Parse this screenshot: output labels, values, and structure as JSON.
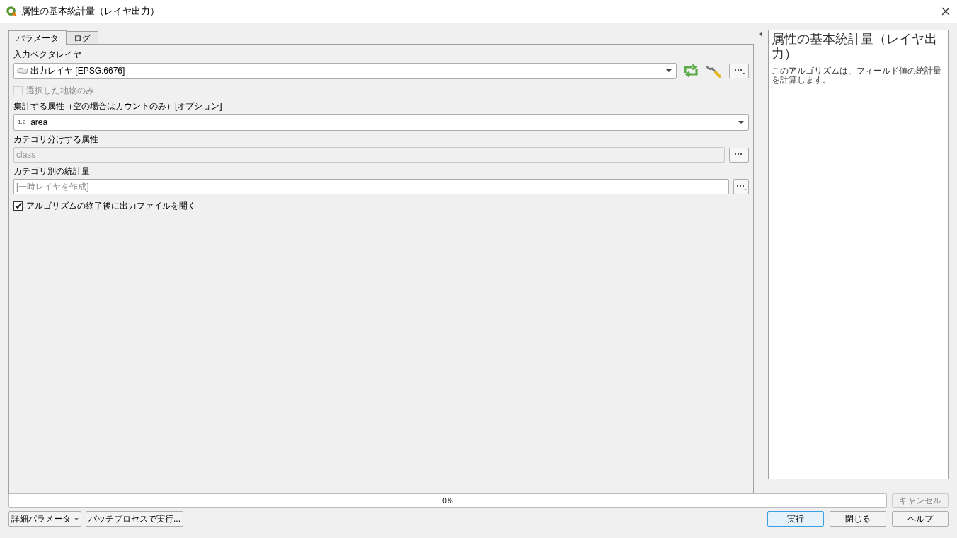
{
  "window": {
    "title": "属性の基本統計量（レイヤ出力）"
  },
  "tabs": [
    {
      "label": "パラメータ",
      "selected": true
    },
    {
      "label": "ログ",
      "selected": false
    }
  ],
  "params": [
    {
      "kind": "layer",
      "label": "入力ベクタレイヤ",
      "value": "出力レイヤ [EPSG:6676]"
    },
    {
      "kind": "checkbox",
      "label": "選択した地物のみ",
      "checked": false,
      "disabled": true
    },
    {
      "kind": "field",
      "label": "集計する属性（空の場合はカウントのみ）[オプション]",
      "type_tag": "1.2",
      "value": "area"
    },
    {
      "kind": "text",
      "label": "カテゴリ分けする属性",
      "value": "class",
      "disabled": true
    },
    {
      "kind": "output",
      "label": "カテゴリ別の統計量",
      "placeholder": "[一時レイヤを作成]"
    },
    {
      "kind": "checkbox",
      "label": "アルゴリズムの終了後に出力ファイルを開く",
      "checked": true,
      "disabled": false
    }
  ],
  "help": {
    "title": "属性の基本統計量（レイヤ出力）",
    "text": "このアルゴリズムは、フィールド値の統計量を計算します。"
  },
  "progress": {
    "level": 0,
    "reading": "0%"
  },
  "cancel": {
    "label": "キャンセル",
    "disabled": true
  },
  "left_buttons": [
    {
      "label": "詳細パラメータ",
      "kind": "dropdown"
    },
    {
      "label": "バッチプロセスで実行...",
      "kind": "plain"
    }
  ],
  "right_buttons": [
    {
      "label": "実行",
      "default": true
    },
    {
      "label": "閉じる",
      "default": false
    },
    {
      "label": "ヘルプ",
      "default": false
    }
  ]
}
